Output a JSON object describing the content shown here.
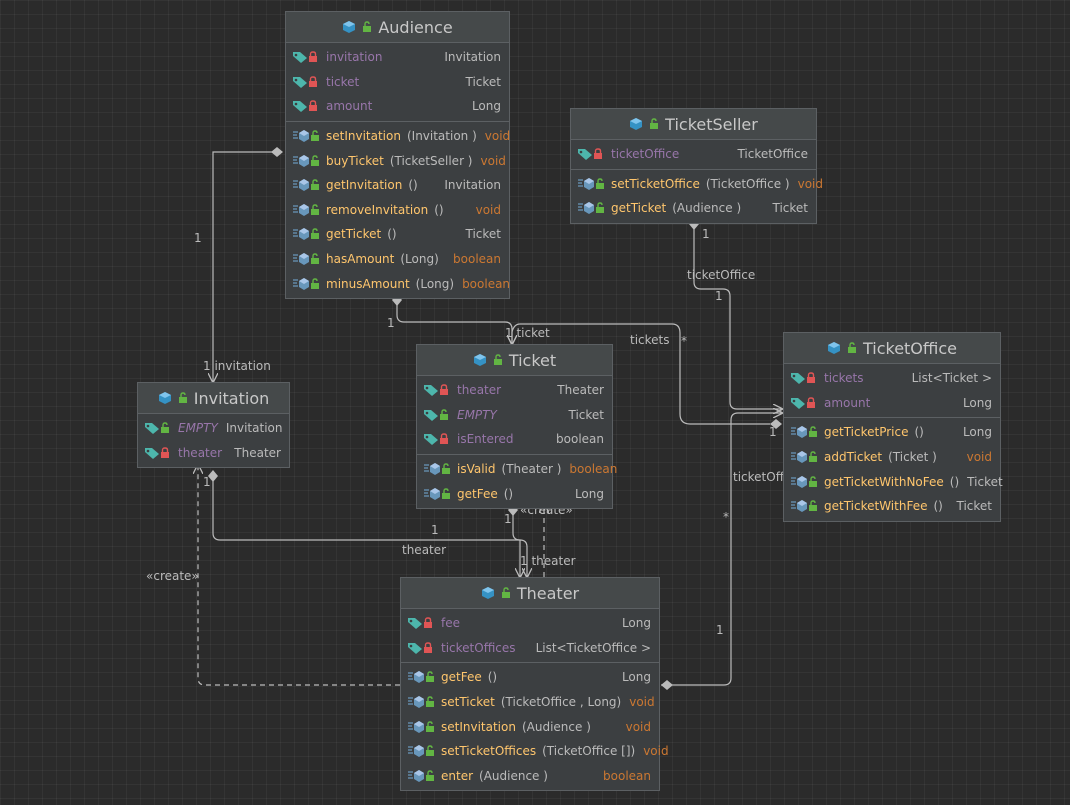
{
  "classes": {
    "audience": {
      "name": "Audience",
      "fields": [
        {
          "name": "invitation",
          "type": "Invitation",
          "static": false
        },
        {
          "name": "ticket",
          "type": "Ticket",
          "static": false
        },
        {
          "name": "amount",
          "type": "Long",
          "static": false
        }
      ],
      "methods": [
        {
          "name": "setInvitation",
          "params": "(Invitation )",
          "type": "void"
        },
        {
          "name": "buyTicket",
          "params": "(TicketSeller )",
          "type": "void"
        },
        {
          "name": "getInvitation",
          "params": "()",
          "type": "Invitation"
        },
        {
          "name": "removeInvitation",
          "params": "()",
          "type": "void"
        },
        {
          "name": "getTicket",
          "params": "()",
          "type": "Ticket"
        },
        {
          "name": "hasAmount",
          "params": "(Long)",
          "type": "boolean"
        },
        {
          "name": "minusAmount",
          "params": "(Long)",
          "type": "boolean"
        }
      ]
    },
    "ticket_seller": {
      "name": "TicketSeller",
      "fields": [
        {
          "name": "ticketOffice",
          "type": "TicketOffice",
          "static": false
        }
      ],
      "methods": [
        {
          "name": "setTicketOffice",
          "params": "(TicketOffice )",
          "type": "void"
        },
        {
          "name": "getTicket",
          "params": "(Audience )",
          "type": "Ticket"
        }
      ]
    },
    "ticket": {
      "name": "Ticket",
      "fields": [
        {
          "name": "theater",
          "type": "Theater",
          "static": false
        },
        {
          "name": "EMPTY",
          "type": "Ticket",
          "static": true
        },
        {
          "name": "isEntered",
          "type": "boolean",
          "static": false
        }
      ],
      "methods": [
        {
          "name": "isValid",
          "params": "(Theater )",
          "type": "boolean"
        },
        {
          "name": "getFee",
          "params": "()",
          "type": "Long"
        }
      ]
    },
    "invitation": {
      "name": "Invitation",
      "fields": [
        {
          "name": "EMPTY",
          "type": "Invitation",
          "static": true
        },
        {
          "name": "theater",
          "type": "Theater",
          "static": false
        }
      ],
      "methods": []
    },
    "ticket_office": {
      "name": "TicketOffice",
      "fields": [
        {
          "name": "tickets",
          "type": "List<Ticket >",
          "static": false
        },
        {
          "name": "amount",
          "type": "Long",
          "static": false
        }
      ],
      "methods": [
        {
          "name": "getTicketPrice",
          "params": "()",
          "type": "Long"
        },
        {
          "name": "addTicket",
          "params": "(Ticket )",
          "type": "void"
        },
        {
          "name": "getTicketWithNoFee",
          "params": "()",
          "type": "Ticket"
        },
        {
          "name": "getTicketWithFee",
          "params": "()",
          "type": "Ticket"
        }
      ]
    },
    "theater": {
      "name": "Theater",
      "fields": [
        {
          "name": "fee",
          "type": "Long",
          "static": false
        },
        {
          "name": "ticketOffices",
          "type": "List<TicketOffice >",
          "static": false
        }
      ],
      "methods": [
        {
          "name": "getFee",
          "params": "()",
          "type": "Long"
        },
        {
          "name": "setTicket",
          "params": "(TicketOffice , Long)",
          "type": "void"
        },
        {
          "name": "setInvitation",
          "params": "(Audience )",
          "type": "void"
        },
        {
          "name": "setTicketOffices",
          "params": "(TicketOffice [])",
          "type": "void"
        },
        {
          "name": "enter",
          "params": "(Audience )",
          "type": "boolean"
        }
      ]
    }
  },
  "edge_labels": {
    "aud_inv_mult": "1",
    "aud_inv_target": "1 invitation",
    "aud_ticket_src": "1",
    "aud_ticket_target": "1 ticket",
    "seller_office_mult": "1",
    "seller_office_role": "ticketOffice",
    "seller_office_target": "1",
    "office_tickets_role": "tickets",
    "office_tickets_mult": "*",
    "theater_offices_src": "1",
    "theater_offices_role": "ticketOffice",
    "theater_offices_mult": "*",
    "office_diamond_mult": "1",
    "inv_theater_src": "1",
    "inv_theater_mid": "1",
    "inv_theater_role": "theater",
    "ticket_theater_src": "1",
    "ticket_theater_target": "1 theater",
    "create_ticket": "«create»",
    "create_invitation": "«create»"
  },
  "icons": {
    "class": "class-icon",
    "lock_open": "unlocked-icon",
    "lock_closed": "private-icon",
    "field": "field-icon",
    "method": "method-icon"
  },
  "colors": {
    "background": "#2b2b2b",
    "node": "#3c3f41",
    "field_name": "#9876aa",
    "method_name": "#ffc66d",
    "keyword_type": "#cc7832",
    "class_icon": "#3592c4",
    "private": "#e05555",
    "public": "#62b543",
    "field_tag": "#4db6ac",
    "method_blue": "#6897bb"
  }
}
